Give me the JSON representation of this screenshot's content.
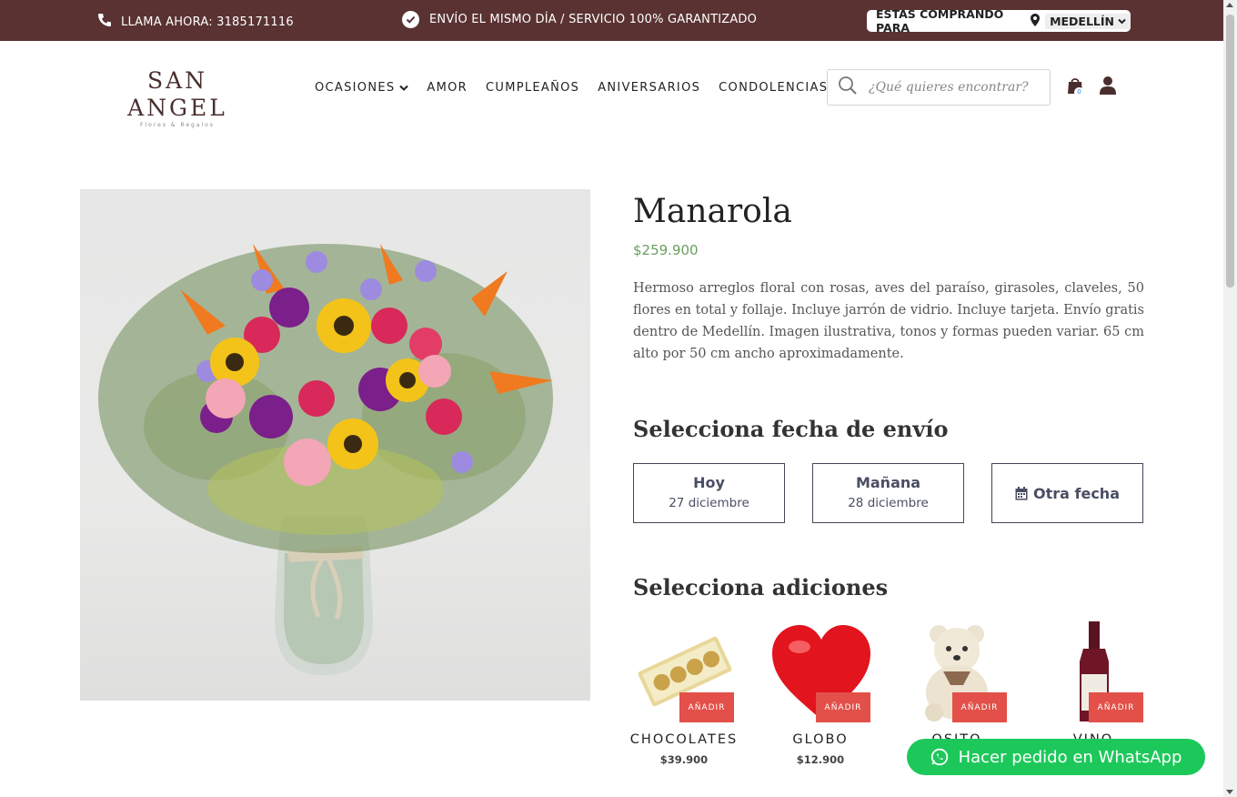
{
  "topbar": {
    "call_text": "LLAMA AHORA: 3185171116",
    "shipping_text": "ENVÍO EL MISMO DÍA / SERVICIO 100% GARANTIZADO",
    "buying_for_label": "ESTAS COMPRANDO PARA",
    "city": "MEDELLÍN",
    "bg_color": "#5a3232"
  },
  "header": {
    "logo_name": "SAN ANGEL",
    "logo_sub": "Flores & Regalos",
    "nav": [
      "OCASIONES",
      "AMOR",
      "CUMPLEAÑOS",
      "ANIVERSARIOS",
      "CONDOLENCIAS"
    ],
    "search_placeholder": "¿Qué quieres encontrar?",
    "cart_count": "0"
  },
  "product": {
    "name": "Manarola",
    "price": "$259.900",
    "description": "Hermoso arreglos floral con rosas, aves del paraíso, girasoles, claveles, 50 flores en total y follaje. Incluye jarrón de vidrio. Incluye tarjeta. Envío gratis dentro de Medellín. Imagen ilustrativa, tonos y formas pueden variar. 65 cm alto por 50 cm ancho aproximadamente."
  },
  "delivery": {
    "title": "Selecciona fecha de envío",
    "options": [
      {
        "label": "Hoy",
        "date": "27 diciembre"
      },
      {
        "label": "Mañana",
        "date": "28 diciembre"
      }
    ],
    "other_label": "Otra fecha"
  },
  "additions": {
    "title": "Selecciona adiciones",
    "add_label": "AÑADIR",
    "items": [
      {
        "name": "CHOCOLATES",
        "price": "$39.900"
      },
      {
        "name": "GLOBO",
        "price": "$12.900"
      },
      {
        "name": "OSITO",
        "price": ""
      },
      {
        "name": "VINO",
        "price": ""
      }
    ]
  },
  "whatsapp": {
    "label": "Hacer pedido en WhatsApp",
    "color": "#1dc85a"
  },
  "colors": {
    "price": "#6a9e5e",
    "add_button": "#e25049",
    "date_border": "#44475a"
  }
}
